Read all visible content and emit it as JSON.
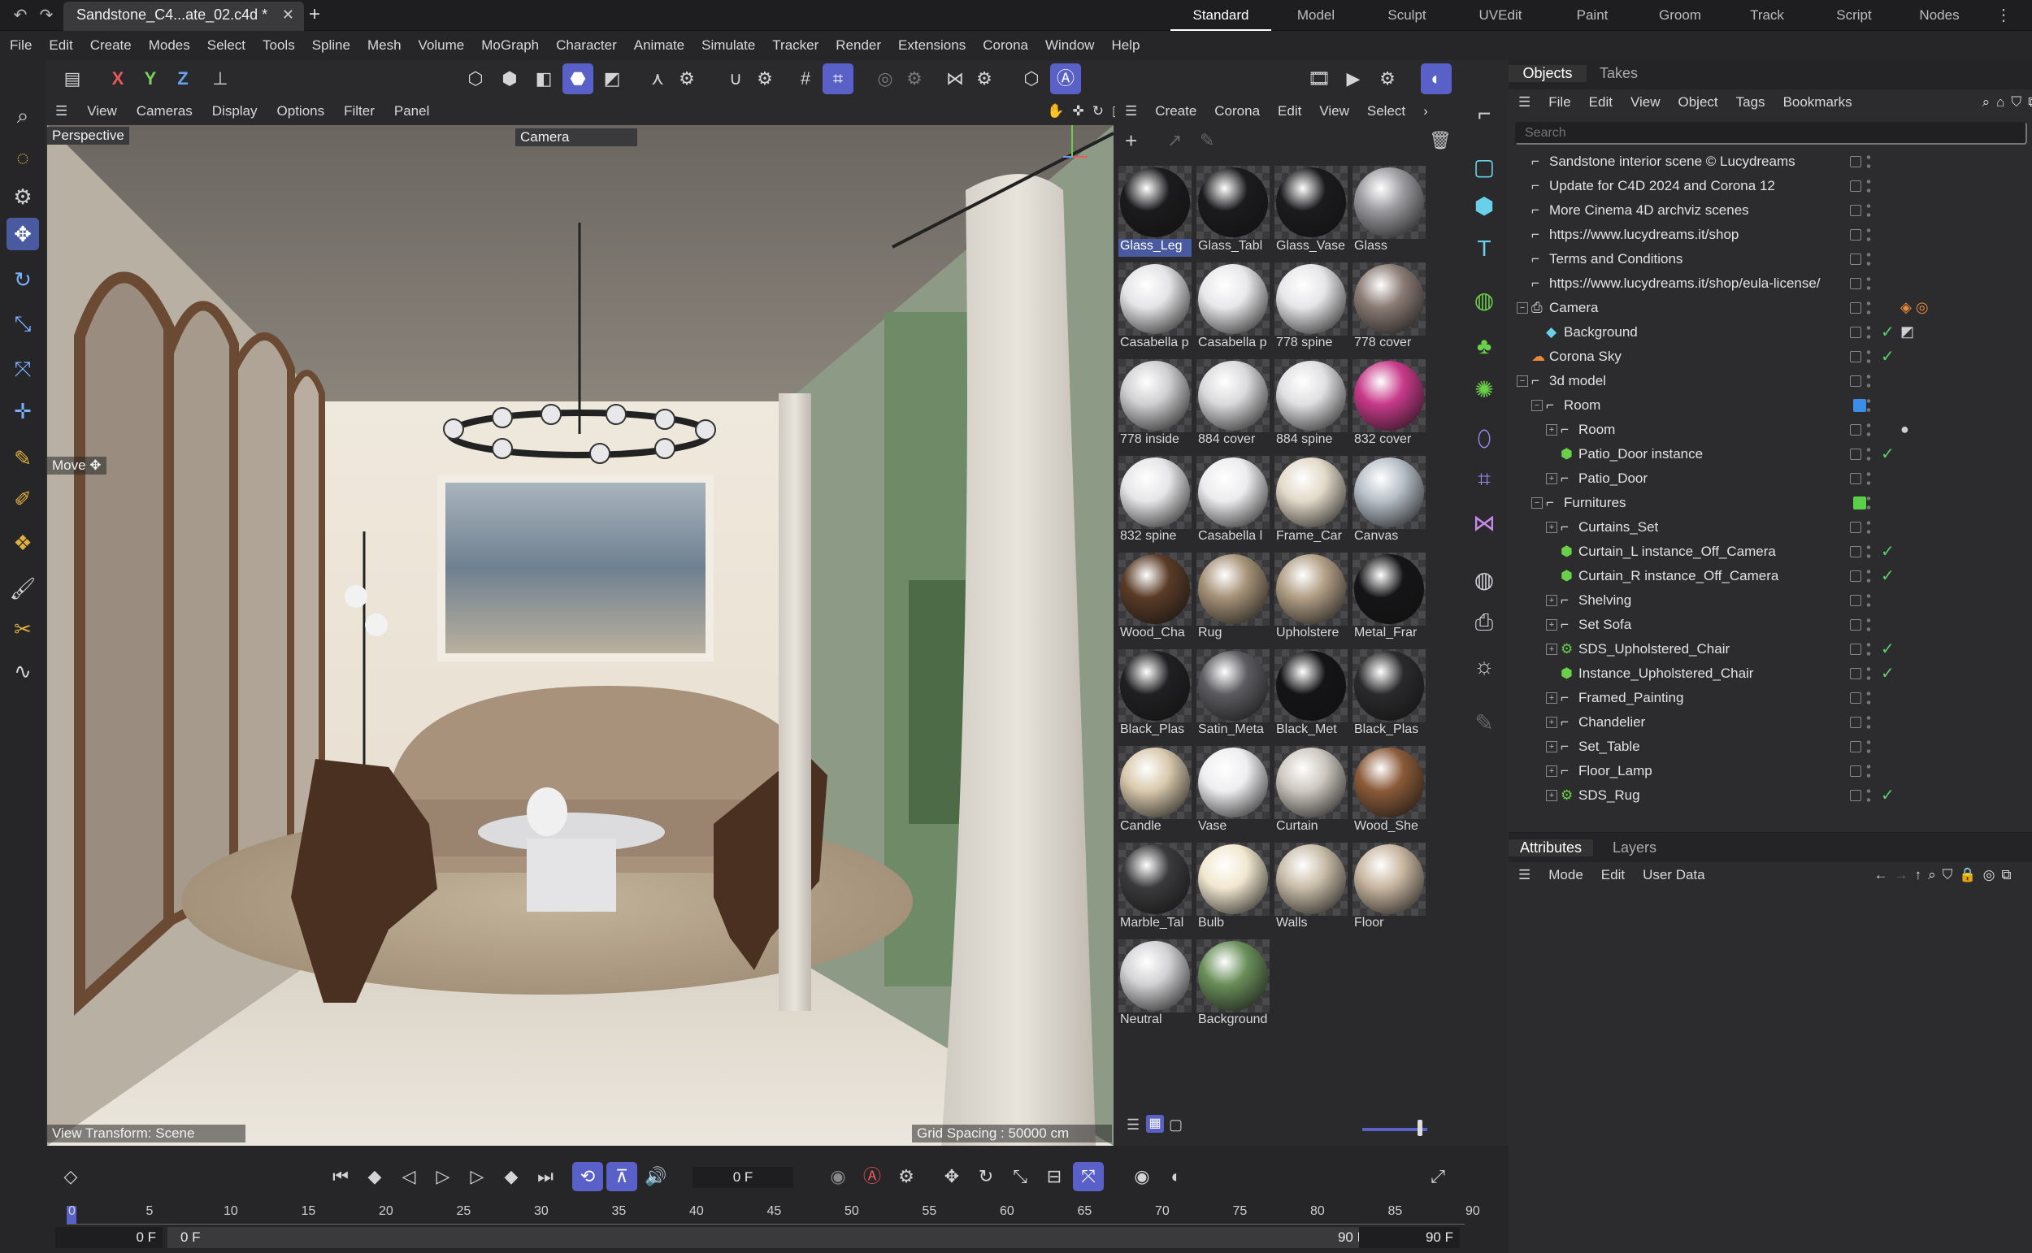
{
  "titlebar": {
    "doc_tab": "Sandstone_C4...ate_02.c4d *",
    "close": "✕",
    "add": "+",
    "layouts": [
      "Standard",
      "Model",
      "Sculpt",
      "UVEdit",
      "Paint",
      "Groom",
      "Track",
      "Script",
      "Nodes"
    ],
    "active_layout": "Standard"
  },
  "menubar": [
    "File",
    "Edit",
    "Create",
    "Modes",
    "Select",
    "Tools",
    "Spline",
    "Mesh",
    "Volume",
    "MoGraph",
    "Character",
    "Animate",
    "Simulate",
    "Tracker",
    "Render",
    "Extensions",
    "Corona",
    "Window",
    "Help"
  ],
  "toptools": {
    "x": "X",
    "y": "Y",
    "z": "Z"
  },
  "viewport": {
    "menu": [
      "View",
      "Cameras",
      "Display",
      "Options",
      "Filter",
      "Panel"
    ],
    "label": "Perspective",
    "camera": "Camera",
    "move_label": "Move",
    "view_transform": "View Transform: Scene",
    "grid_spacing": "Grid Spacing : 50000 cm"
  },
  "materials": {
    "menu": [
      "Create",
      "Corona",
      "Edit",
      "View",
      "Select"
    ],
    "items": [
      {
        "name": "Glass_Leg",
        "color": "#1b1b1d",
        "selected": true
      },
      {
        "name": "Glass_Tabl",
        "color": "#1b1b1d"
      },
      {
        "name": "Glass_Vase",
        "color": "#1b1b1d"
      },
      {
        "name": "Glass",
        "color": "#9a9a9e"
      },
      {
        "name": "Casabella p",
        "color": "#e4e4e6"
      },
      {
        "name": "Casabella p",
        "color": "#e8e8ea"
      },
      {
        "name": "778 spine",
        "color": "#e6e6e8"
      },
      {
        "name": "778 cover",
        "color": "#8a7b74"
      },
      {
        "name": "778 inside",
        "color": "#cfcfd1"
      },
      {
        "name": "884 cover",
        "color": "#dadadc"
      },
      {
        "name": "884 spine",
        "color": "#e0e0e2"
      },
      {
        "name": "832 cover",
        "color": "#c83a8a"
      },
      {
        "name": "832 spine",
        "color": "#e6e6e8"
      },
      {
        "name": "Casabella l",
        "color": "#ececee"
      },
      {
        "name": "Frame_Car",
        "color": "#e2d9c8"
      },
      {
        "name": "Canvas",
        "color": "#b7c0c8"
      },
      {
        "name": "Wood_Cha",
        "color": "#5a3b27"
      },
      {
        "name": "Rug",
        "color": "#a69278"
      },
      {
        "name": "Upholstere",
        "color": "#b29f86"
      },
      {
        "name": "Metal_Frar",
        "color": "#151517"
      },
      {
        "name": "Black_Plas",
        "color": "#202022"
      },
      {
        "name": "Satin_Meta",
        "color": "#5c5c60"
      },
      {
        "name": "Black_Met",
        "color": "#141416"
      },
      {
        "name": "Black_Plas",
        "color": "#2a2a2c"
      },
      {
        "name": "Candle",
        "color": "#d9c9ad"
      },
      {
        "name": "Vase",
        "color": "#eeeef0"
      },
      {
        "name": "Curtain",
        "color": "#cdc8c0"
      },
      {
        "name": "Wood_She",
        "color": "#8a5a38"
      },
      {
        "name": "Marble_Tal",
        "color": "#3a3a3c"
      },
      {
        "name": "Bulb",
        "color": "#f2e8d0"
      },
      {
        "name": "Walls",
        "color": "#c9bda9"
      },
      {
        "name": "Floor",
        "color": "#c8b6a0"
      },
      {
        "name": "Neutral",
        "color": "#d2d2d4"
      },
      {
        "name": "Background",
        "color": "#6a8f5a"
      }
    ]
  },
  "objects": {
    "tabs": [
      "Objects",
      "Takes"
    ],
    "menu": [
      "File",
      "Edit",
      "View",
      "Object",
      "Tags",
      "Bookmarks"
    ],
    "search_placeholder": "Search",
    "rows": [
      {
        "name": "Sandstone interior scene © Lucydreams",
        "indent": 0,
        "icon": "null-icon",
        "expand": false
      },
      {
        "name": "Update for C4D 2024 and Corona 12",
        "indent": 0,
        "icon": "null-icon",
        "expand": false
      },
      {
        "name": "More Cinema 4D archviz scenes",
        "indent": 0,
        "icon": "null-icon",
        "expand": false
      },
      {
        "name": "https://www.lucydreams.it/shop",
        "indent": 0,
        "icon": "null-icon",
        "expand": false
      },
      {
        "name": "Terms and Conditions",
        "indent": 0,
        "icon": "null-icon",
        "expand": false
      },
      {
        "name": "https://www.lucydreams.it/shop/eula-license/",
        "indent": 0,
        "icon": "null-icon",
        "expand": false
      },
      {
        "name": "Camera",
        "indent": 0,
        "icon": "camera-icon",
        "expand": "minus",
        "tags": "camera-tags"
      },
      {
        "name": "Background",
        "indent": 1,
        "icon": "background-icon",
        "expand": false,
        "tick": true,
        "tags": "bg-tags"
      },
      {
        "name": "Corona Sky",
        "indent": 0,
        "icon": "sky-icon",
        "expand": false,
        "tick": true
      },
      {
        "name": "3d model",
        "indent": 0,
        "icon": "null-icon",
        "expand": "minus"
      },
      {
        "name": "Room",
        "indent": 1,
        "icon": "null-icon",
        "expand": "minus",
        "layer": "#3a8ee8"
      },
      {
        "name": "Room",
        "indent": 2,
        "icon": "null-icon",
        "expand": "plus",
        "tags": "material-tag"
      },
      {
        "name": "Patio_Door instance",
        "indent": 2,
        "icon": "instance-icon",
        "expand": false,
        "tick": true
      },
      {
        "name": "Patio_Door",
        "indent": 2,
        "icon": "null-icon",
        "expand": "plus"
      },
      {
        "name": "Furnitures",
        "indent": 1,
        "icon": "null-icon",
        "expand": "minus",
        "layer": "#5ad04a"
      },
      {
        "name": "Curtains_Set",
        "indent": 2,
        "icon": "null-icon",
        "expand": "plus"
      },
      {
        "name": "Curtain_L instance_Off_Camera",
        "indent": 2,
        "icon": "instance-icon",
        "expand": false,
        "tick": true
      },
      {
        "name": "Curtain_R instance_Off_Camera",
        "indent": 2,
        "icon": "instance-icon",
        "expand": false,
        "tick": true
      },
      {
        "name": "Shelving",
        "indent": 2,
        "icon": "null-icon",
        "expand": "plus"
      },
      {
        "name": "Set Sofa",
        "indent": 2,
        "icon": "null-icon",
        "expand": "plus"
      },
      {
        "name": "SDS_Upholstered_Chair",
        "indent": 2,
        "icon": "subdivision-icon",
        "expand": "plus",
        "tick": true
      },
      {
        "name": "Instance_Upholstered_Chair",
        "indent": 2,
        "icon": "instance-icon",
        "expand": false,
        "tick": true
      },
      {
        "name": "Framed_Painting",
        "indent": 2,
        "icon": "null-icon",
        "expand": "plus"
      },
      {
        "name": "Chandelier",
        "indent": 2,
        "icon": "null-icon",
        "expand": "plus"
      },
      {
        "name": "Set_Table",
        "indent": 2,
        "icon": "null-icon",
        "expand": "plus"
      },
      {
        "name": "Floor_Lamp",
        "indent": 2,
        "icon": "null-icon",
        "expand": "plus"
      },
      {
        "name": "SDS_Rug",
        "indent": 2,
        "icon": "subdivision-icon",
        "expand": "plus",
        "tick": true
      }
    ]
  },
  "attributes": {
    "tabs": [
      "Attributes",
      "Layers"
    ],
    "menu": [
      "Mode",
      "Edit",
      "User Data"
    ]
  },
  "timeline": {
    "current_frame": "0 F",
    "ticks": [
      "0",
      "5",
      "10",
      "15",
      "20",
      "25",
      "30",
      "35",
      "40",
      "45",
      "50",
      "55",
      "60",
      "65",
      "70",
      "75",
      "80",
      "85",
      "90"
    ],
    "start_field": "0 F",
    "range_start": "0 F",
    "range_end": "90 F",
    "end_field": "90 F"
  }
}
